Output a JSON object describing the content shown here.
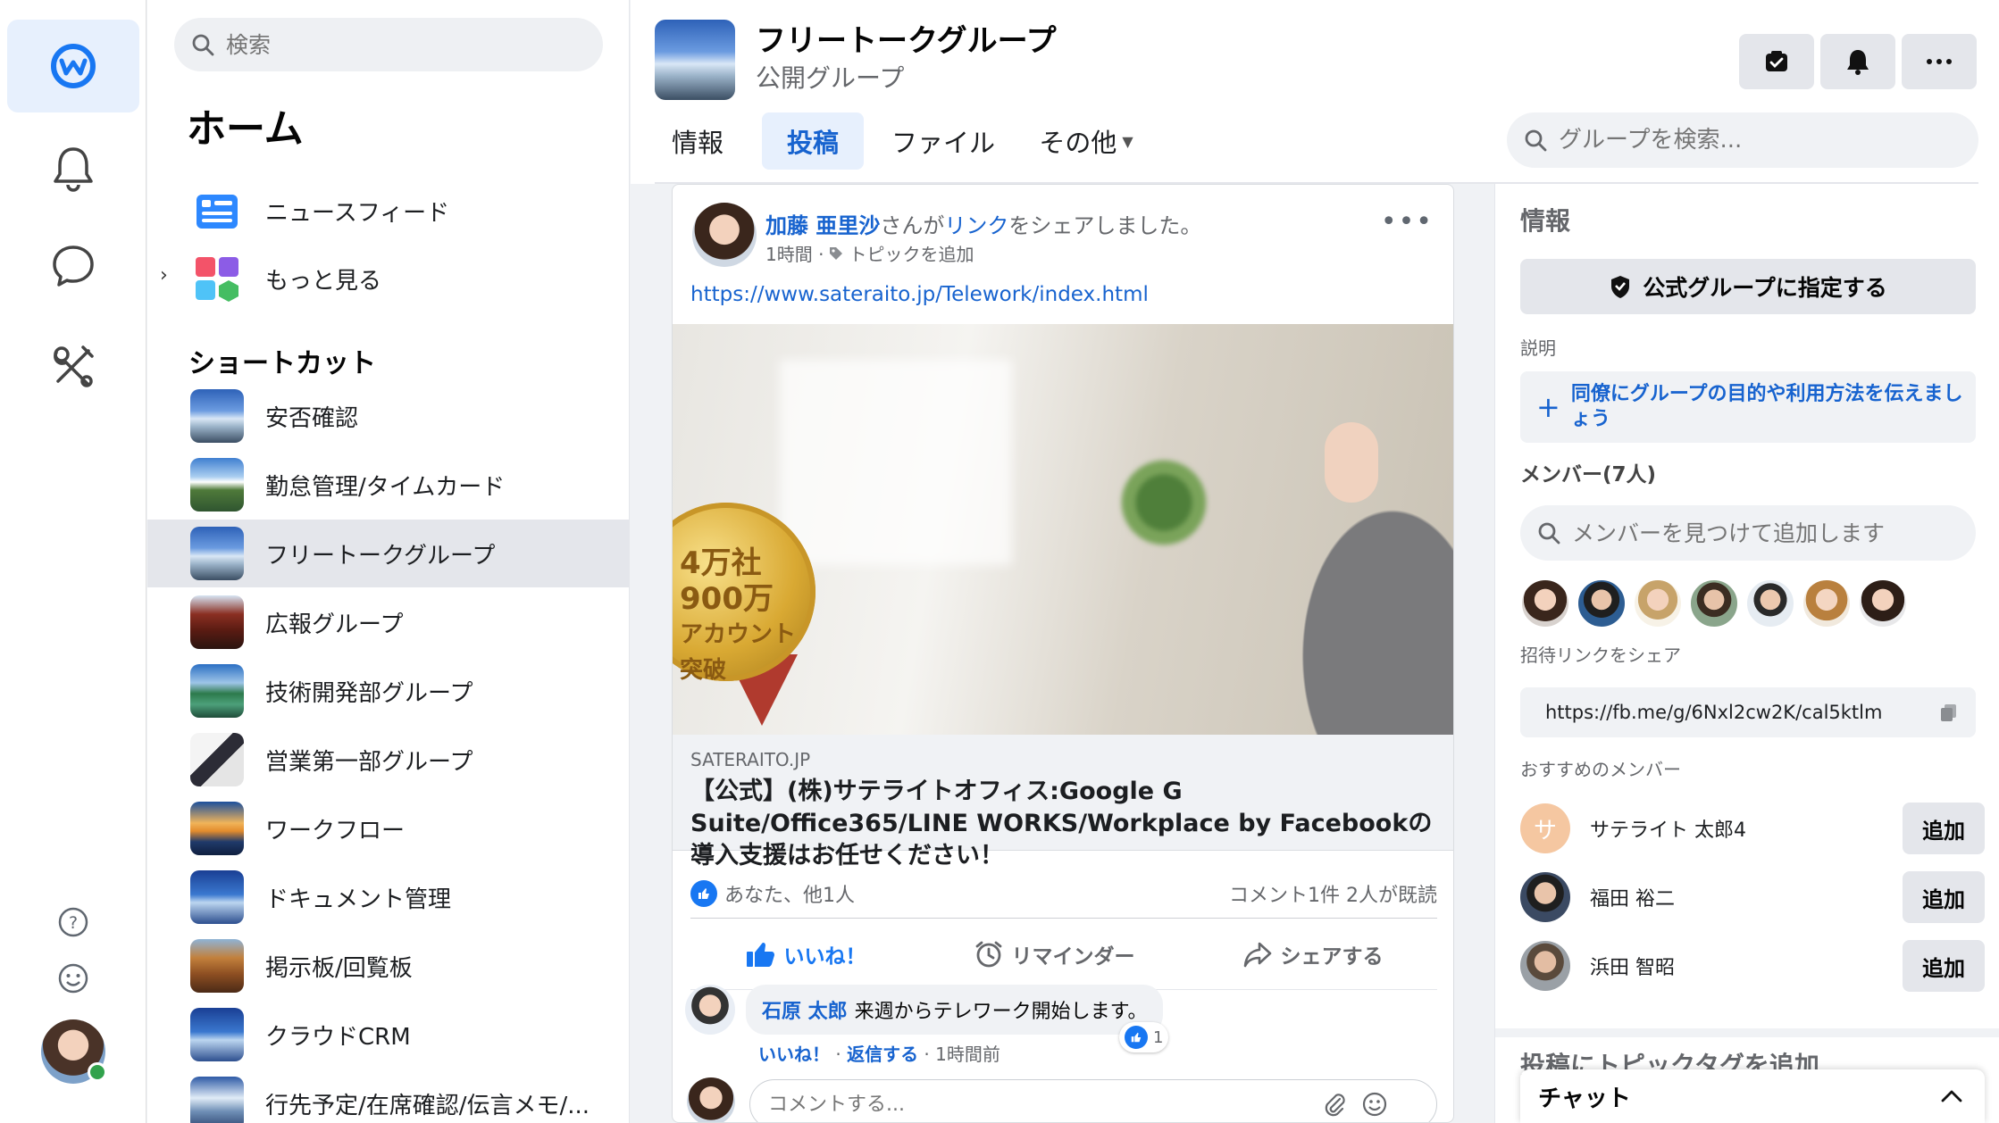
{
  "nav": {
    "search_placeholder": "検索",
    "title": "ホーム",
    "items": [
      {
        "label": "ニュースフィード"
      },
      {
        "label": "もっと見る"
      }
    ],
    "shortcuts_title": "ショートカット",
    "shortcuts": [
      {
        "label": "安否確認"
      },
      {
        "label": "勤怠管理/タイムカード"
      },
      {
        "label": "フリートークグループ"
      },
      {
        "label": "広報グループ"
      },
      {
        "label": "技術開発部グループ"
      },
      {
        "label": "営業第一部グループ"
      },
      {
        "label": "ワークフロー"
      },
      {
        "label": "ドキュメント管理"
      },
      {
        "label": "掲示板/回覧板"
      },
      {
        "label": "クラウドCRM"
      },
      {
        "label": "行先予定/在席確認/伝言メモ/..."
      }
    ]
  },
  "group": {
    "title": "フリートークグループ",
    "subtitle": "公開グループ",
    "tabs": [
      "情報",
      "投稿",
      "ファイル",
      "その他"
    ],
    "search_placeholder": "グループを検索..."
  },
  "post": {
    "author": "加藤 亜里沙",
    "action_mid": "さんが",
    "action_link": "リンク",
    "action_end": "をシェアしました。",
    "time": "1時間 ·",
    "topic": "トピックを追加",
    "url": "https://www.sateraito.jp/Telework/index.html",
    "medal_text": [
      "4万社",
      "900万",
      "アカウント",
      "突破"
    ],
    "link_domain": "SATERAITO.JP",
    "link_title": "【公式】(株)サテライトオフィス:Google G Suite/Office365/LINE WORKS/Workplace by Facebookの導入支援はお任せください！",
    "reactions_text": "あなた、他1人",
    "comments_text": "コメント1件  2人が既読",
    "actions": {
      "like": "いいね！",
      "reminder": "リマインダー",
      "share": "シェアする"
    },
    "comment": {
      "author": "石原 太郎",
      "text": "来週からテレワーク開始します。",
      "like_count": "1",
      "meta_like": "いいね！",
      "meta_reply": "返信する",
      "meta_time": "1時間前"
    },
    "comment_placeholder": "コメントする..."
  },
  "info": {
    "title": "情報",
    "official_button": "公式グループに指定する",
    "description_label": "説明",
    "description_prompt": "同僚にグループの目的や利用方法を伝えましょう",
    "members_title": "メンバー(7人)",
    "member_search_placeholder": "メンバーを見つけて追加します",
    "invite_label": "招待リンクをシェア",
    "invite_link": "https://fb.me/g/6Nxl2cw2K/cal5ktlm",
    "suggest_label": "おすすめのメンバー",
    "suggestions": [
      {
        "name": "サテライト 太郎4",
        "initial": "サ"
      },
      {
        "name": "福田 裕二"
      },
      {
        "name": "浜田 智昭"
      }
    ],
    "add_label": "追加",
    "topic_title": "投稿にトピックタグを追加"
  },
  "chat": {
    "label": "チャット"
  },
  "colors": {
    "accent": "#1763cf",
    "like": "#1877f2",
    "online": "#31a24c"
  }
}
